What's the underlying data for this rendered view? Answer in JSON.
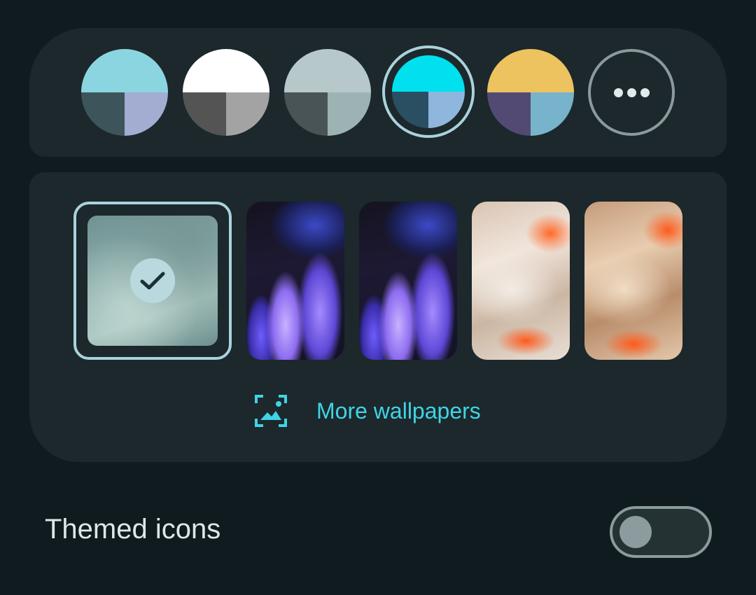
{
  "palette": {
    "swatches": [
      {
        "name": "swatch-1",
        "top": "#8bd5e0",
        "bottom_left": "#3d555a",
        "bottom_right": "#a3acd1"
      },
      {
        "name": "swatch-2",
        "top": "#ffffff",
        "bottom_left": "#545454",
        "bottom_right": "#a3a3a3"
      },
      {
        "name": "swatch-3",
        "top": "#b7c8ca",
        "bottom_left": "#495456",
        "bottom_right": "#9cb2b3"
      },
      {
        "name": "swatch-4",
        "top": "#00e0ef",
        "bottom_left": "#2a4f63",
        "bottom_right": "#8fb7dd",
        "selected": true
      },
      {
        "name": "swatch-5",
        "top": "#edc35f",
        "bottom_left": "#524a73",
        "bottom_right": "#77b3cb"
      }
    ],
    "more_icon": "more-horiz-icon"
  },
  "wallpapers": {
    "items": [
      {
        "name": "wallpaper-current",
        "selected": true
      },
      {
        "name": "wallpaper-purple-1"
      },
      {
        "name": "wallpaper-purple-2"
      },
      {
        "name": "wallpaper-orange-1"
      },
      {
        "name": "wallpaper-orange-2"
      }
    ],
    "selected_icon": "check-icon",
    "more_link_label": "More wallpapers",
    "more_link_icon": "wallpaper-icon"
  },
  "settings": {
    "themed_icons_label": "Themed icons",
    "themed_icons_enabled": false
  }
}
